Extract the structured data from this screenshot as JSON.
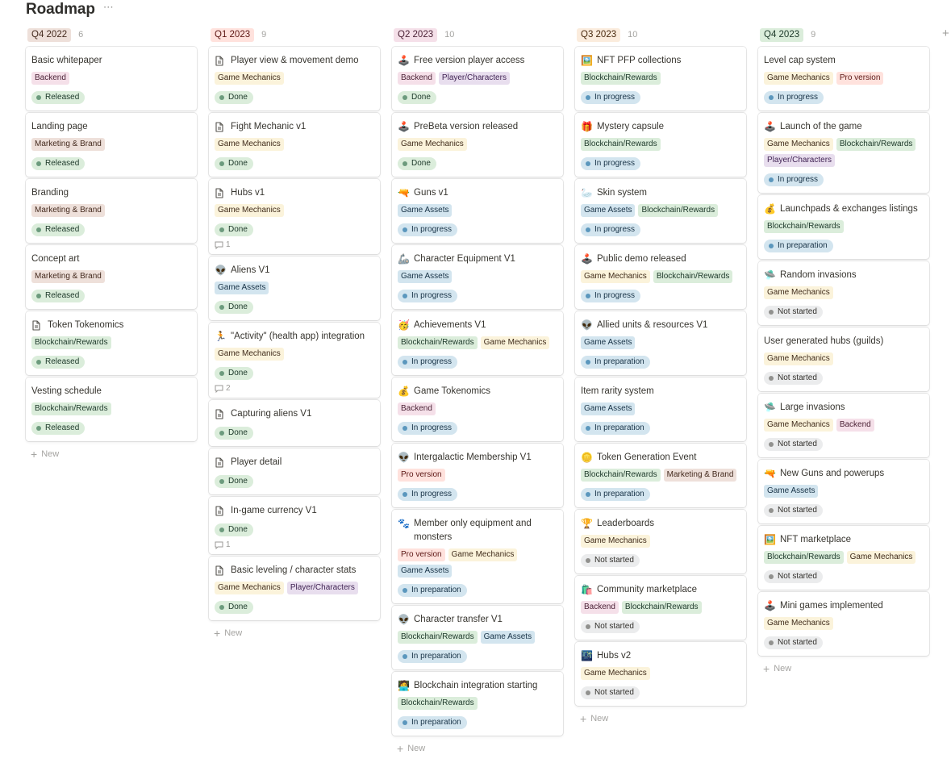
{
  "page": {
    "title": "Roadmap",
    "more_icon": "⋯",
    "add_group_icon": "+"
  },
  "new_label": "New",
  "tag_colors": {
    "Backend": {
      "bg": "#f5e0e9",
      "fg": "#4c2337"
    },
    "Player/Characters": {
      "bg": "#e8deee",
      "fg": "#412454"
    },
    "Game Mechanics": {
      "bg": "#fbf3db",
      "fg": "#402c1b"
    },
    "Blockchain/Rewards": {
      "bg": "#dbeddb",
      "fg": "#1c3829"
    },
    "Marketing & Brand": {
      "bg": "#eee0da",
      "fg": "#442a1e"
    },
    "Game Assets": {
      "bg": "#d3e5ef",
      "fg": "#183347"
    },
    "Pro version": {
      "bg": "#ffe2dd",
      "fg": "#5d1715"
    }
  },
  "status_colors": {
    "Released": {
      "bg": "#dbeddb",
      "fg": "#1c3829",
      "dot": "#6c9b7d"
    },
    "Done": {
      "bg": "#dbeddb",
      "fg": "#1c3829",
      "dot": "#6c9b7d"
    },
    "In progress": {
      "bg": "#d3e5ef",
      "fg": "#183347",
      "dot": "#5b97bd"
    },
    "In preparation": {
      "bg": "#d3e5ef",
      "fg": "#183347",
      "dot": "#5b97bd"
    },
    "Not started": {
      "bg": "#ebeced",
      "fg": "#32302c",
      "dot": "#91918e"
    }
  },
  "columns": [
    {
      "label": "Q4 2022",
      "count": "6",
      "label_bg": "#eee0da",
      "label_fg": "#442a1e",
      "cards": [
        {
          "icon": "",
          "title": "Basic whitepaper",
          "tags": [
            "Backend"
          ],
          "status": "Released"
        },
        {
          "icon": "",
          "title": "Landing page",
          "tags": [
            "Marketing & Brand"
          ],
          "status": "Released"
        },
        {
          "icon": "",
          "title": "Branding",
          "tags": [
            "Marketing & Brand"
          ],
          "status": "Released"
        },
        {
          "icon": "",
          "title": "Concept art",
          "tags": [
            "Marketing & Brand"
          ],
          "status": "Released"
        },
        {
          "icon": "page",
          "title": "Token Tokenomics",
          "tags": [
            "Blockchain/Rewards"
          ],
          "status": "Released"
        },
        {
          "icon": "",
          "title": "Vesting schedule",
          "tags": [
            "Blockchain/Rewards"
          ],
          "status": "Released"
        }
      ]
    },
    {
      "label": "Q1 2023",
      "count": "9",
      "label_bg": "#ffe2dd",
      "label_fg": "#5d1715",
      "cards": [
        {
          "icon": "page",
          "title": "Player view & movement demo",
          "tags": [
            "Game Mechanics"
          ],
          "status": "Done"
        },
        {
          "icon": "page",
          "title": "Fight Mechanic v1",
          "tags": [
            "Game Mechanics"
          ],
          "status": "Done"
        },
        {
          "icon": "page",
          "title": "Hubs v1",
          "tags": [
            "Game Mechanics"
          ],
          "status": "Done",
          "comments": "1"
        },
        {
          "icon": "👽",
          "title": "Aliens V1",
          "tags": [
            "Game Assets"
          ],
          "status": "Done"
        },
        {
          "icon": "🏃",
          "title": "\"Activity\" (health app) integration",
          "tags": [
            "Game Mechanics"
          ],
          "status": "Done",
          "comments": "2"
        },
        {
          "icon": "page",
          "title": "Capturing aliens V1",
          "tags": [],
          "status": "Done"
        },
        {
          "icon": "page",
          "title": "Player detail",
          "tags": [],
          "status": "Done"
        },
        {
          "icon": "page",
          "title": "In-game currency V1",
          "tags": [],
          "status": "Done",
          "comments": "1"
        },
        {
          "icon": "page",
          "title": "Basic leveling / character stats",
          "tags": [
            "Game Mechanics",
            "Player/Characters"
          ],
          "status": "Done"
        }
      ]
    },
    {
      "label": "Q2 2023",
      "count": "10",
      "label_bg": "#f5e0e9",
      "label_fg": "#4c2337",
      "cards": [
        {
          "icon": "🕹️",
          "title": "Free version player access",
          "tags": [
            "Backend",
            "Player/Characters"
          ],
          "status": "Done"
        },
        {
          "icon": "🕹️",
          "title": "PreBeta version released",
          "tags": [
            "Game Mechanics"
          ],
          "status": "Done"
        },
        {
          "icon": "🔫",
          "title": "Guns v1",
          "tags": [
            "Game Assets"
          ],
          "status": "In progress"
        },
        {
          "icon": "🦾",
          "title": "Character Equipment V1",
          "tags": [
            "Game Assets"
          ],
          "status": "In progress"
        },
        {
          "icon": "🥳",
          "title": "Achievements V1",
          "tags": [
            "Blockchain/Rewards",
            "Game Mechanics"
          ],
          "status": "In progress"
        },
        {
          "icon": "💰",
          "title": "Game Tokenomics",
          "tags": [
            "Backend"
          ],
          "status": "In progress"
        },
        {
          "icon": "👽",
          "title": "Intergalactic Membership V1",
          "tags": [
            "Pro version"
          ],
          "status": "In progress"
        },
        {
          "icon": "🐾",
          "title": "Member only equipment and monsters",
          "tags": [
            "Pro version",
            "Game Mechanics",
            "Game Assets"
          ],
          "status": "In preparation"
        },
        {
          "icon": "👽",
          "title": "Character transfer V1",
          "tags": [
            "Blockchain/Rewards",
            "Game Assets"
          ],
          "status": "In preparation"
        },
        {
          "icon": "🧑‍💻",
          "title": "Blockchain integration starting",
          "tags": [
            "Blockchain/Rewards"
          ],
          "status": "In preparation"
        }
      ]
    },
    {
      "label": "Q3 2023",
      "count": "10",
      "label_bg": "#fbecdd",
      "label_fg": "#49290e",
      "cards": [
        {
          "icon": "🖼️",
          "title": "NFT PFP collections",
          "tags": [
            "Blockchain/Rewards"
          ],
          "status": "In progress"
        },
        {
          "icon": "🎁",
          "title": "Mystery capsule",
          "tags": [
            "Blockchain/Rewards"
          ],
          "status": "In progress"
        },
        {
          "icon": "🦢",
          "title": "Skin system",
          "tags": [
            "Game Assets",
            "Blockchain/Rewards"
          ],
          "status": "In progress"
        },
        {
          "icon": "🕹️",
          "title": "Public demo released",
          "tags": [
            "Game Mechanics",
            "Blockchain/Rewards"
          ],
          "status": "In progress"
        },
        {
          "icon": "👽",
          "title": "Allied units & resources V1",
          "tags": [
            "Game Assets"
          ],
          "status": "In preparation"
        },
        {
          "icon": "",
          "title": "Item rarity system",
          "tags": [
            "Game Assets"
          ],
          "status": "In preparation"
        },
        {
          "icon": "🪙",
          "title": "Token Generation Event",
          "tags": [
            "Blockchain/Rewards",
            "Marketing & Brand"
          ],
          "status": "In preparation"
        },
        {
          "icon": "🏆",
          "title": "Leaderboards",
          "tags": [
            "Game Mechanics"
          ],
          "status": "Not started"
        },
        {
          "icon": "🛍️",
          "title": "Community marketplace",
          "tags": [
            "Backend",
            "Blockchain/Rewards"
          ],
          "status": "Not started"
        },
        {
          "icon": "🌃",
          "title": "Hubs v2",
          "tags": [
            "Game Mechanics"
          ],
          "status": "Not started"
        }
      ]
    },
    {
      "label": "Q4 2023",
      "count": "9",
      "label_bg": "#dbeddb",
      "label_fg": "#1c3829",
      "cards": [
        {
          "icon": "",
          "title": "Level cap system",
          "tags": [
            "Game Mechanics",
            "Pro version"
          ],
          "status": "In progress"
        },
        {
          "icon": "🕹️",
          "title": "Launch of the game",
          "tags": [
            "Game Mechanics",
            "Blockchain/Rewards",
            "Player/Characters"
          ],
          "status": "In progress"
        },
        {
          "icon": "💰",
          "title": "Launchpads & exchanges listings",
          "tags": [
            "Blockchain/Rewards"
          ],
          "status": "In preparation"
        },
        {
          "icon": "🛸",
          "title": "Random invasions",
          "tags": [
            "Game Mechanics"
          ],
          "status": "Not started"
        },
        {
          "icon": "",
          "title": "User generated hubs (guilds)",
          "tags": [
            "Game Mechanics"
          ],
          "status": "Not started"
        },
        {
          "icon": "🛸",
          "title": "Large invasions",
          "tags": [
            "Game Mechanics",
            "Backend"
          ],
          "status": "Not started"
        },
        {
          "icon": "🔫",
          "title": "New Guns and powerups",
          "tags": [
            "Game Assets"
          ],
          "status": "Not started"
        },
        {
          "icon": "🖼️",
          "title": "NFT marketplace",
          "tags": [
            "Blockchain/Rewards",
            "Game Mechanics"
          ],
          "status": "Not started"
        },
        {
          "icon": "🕹️",
          "title": "Mini games implemented",
          "tags": [
            "Game Mechanics"
          ],
          "status": "Not started"
        }
      ]
    }
  ]
}
